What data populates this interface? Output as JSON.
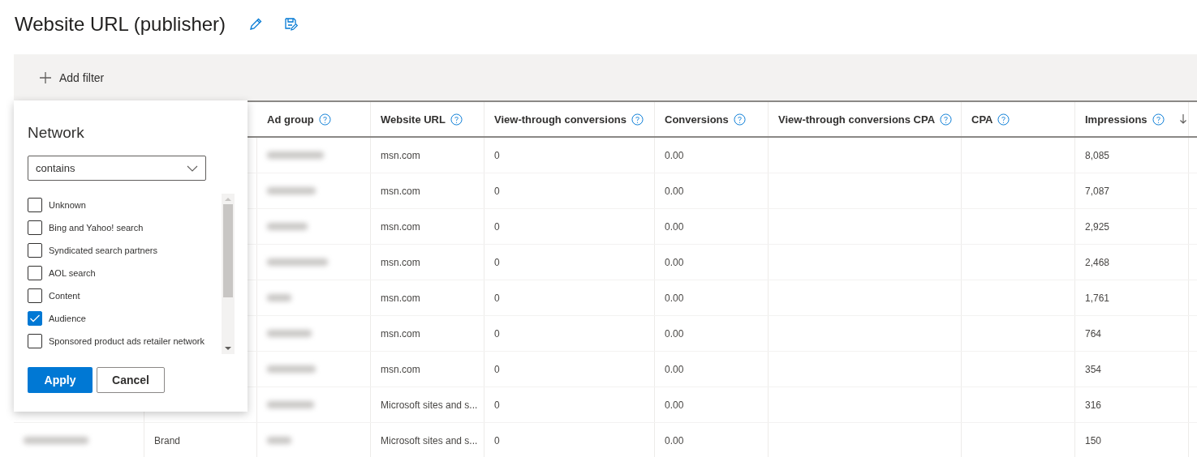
{
  "page_title": "Website URL (publisher)",
  "toolbar": {
    "add_filter": "Add filter"
  },
  "table": {
    "columns": [
      {
        "label": "Ad group",
        "sorted": false
      },
      {
        "label": "Website URL",
        "sorted": false
      },
      {
        "label": "View-through conversions",
        "sorted": false
      },
      {
        "label": "Conversions",
        "sorted": false
      },
      {
        "label": "View-through conversions CPA",
        "sorted": false
      },
      {
        "label": "CPA",
        "sorted": false
      },
      {
        "label": "Impressions",
        "sorted": true
      }
    ],
    "rows": [
      {
        "website_url": "msn.com",
        "view_through_conversions": "0",
        "conversions": "0.00",
        "impressions": "8,085"
      },
      {
        "website_url": "msn.com",
        "view_through_conversions": "0",
        "conversions": "0.00",
        "impressions": "7,087"
      },
      {
        "website_url": "msn.com",
        "view_through_conversions": "0",
        "conversions": "0.00",
        "impressions": "2,925"
      },
      {
        "website_url": "msn.com",
        "view_through_conversions": "0",
        "conversions": "0.00",
        "impressions": "2,468"
      },
      {
        "website_url": "msn.com",
        "view_through_conversions": "0",
        "conversions": "0.00",
        "impressions": "1,761"
      },
      {
        "website_url": "msn.com",
        "view_through_conversions": "0",
        "conversions": "0.00",
        "impressions": "764"
      },
      {
        "website_url": "msn.com",
        "view_through_conversions": "0",
        "conversions": "0.00",
        "impressions": "354"
      },
      {
        "website_url": "Microsoft sites and s...",
        "view_through_conversions": "0",
        "conversions": "0.00",
        "impressions": "316"
      },
      {
        "column_2": "Brand",
        "website_url": "Microsoft sites and s...",
        "view_through_conversions": "0",
        "conversions": "0.00",
        "impressions": "150"
      }
    ]
  },
  "filter_panel": {
    "title": "Network",
    "operator": "contains",
    "options": [
      {
        "label": "Unknown",
        "checked": false
      },
      {
        "label": "Bing and Yahoo! search",
        "checked": false
      },
      {
        "label": "Syndicated search partners",
        "checked": false
      },
      {
        "label": "AOL search",
        "checked": false
      },
      {
        "label": "Content",
        "checked": false
      },
      {
        "label": "Audience",
        "checked": true
      },
      {
        "label": "Sponsored product ads retailer network",
        "checked": false
      }
    ],
    "buttons": [
      {
        "label": "Apply",
        "kind": "primary"
      },
      {
        "label": "Cancel",
        "kind": "secondary"
      }
    ]
  }
}
